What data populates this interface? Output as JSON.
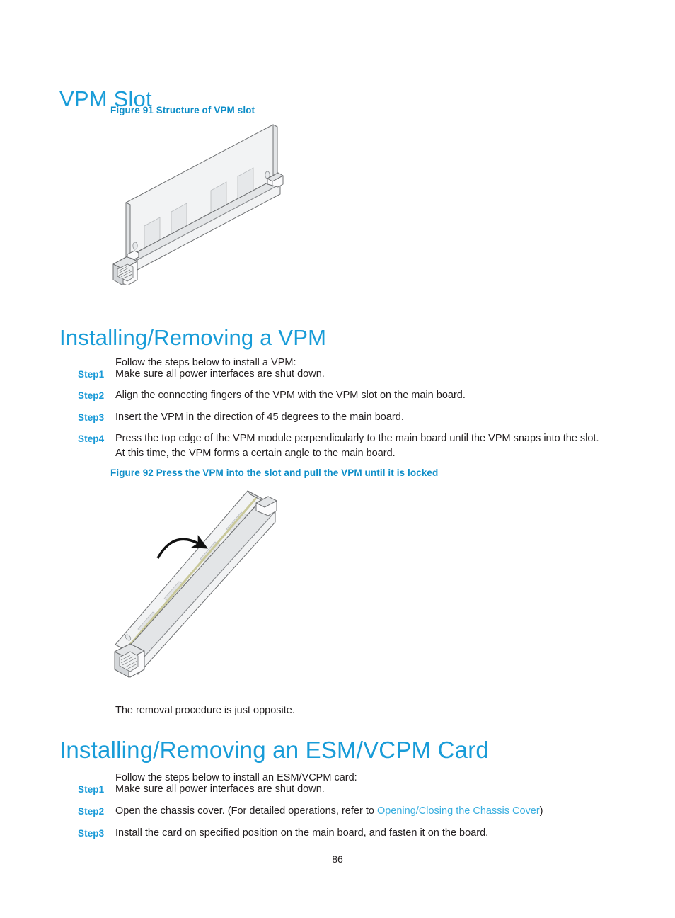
{
  "page": {
    "number": "86"
  },
  "sections": {
    "vpm_slot": {
      "heading": "VPM Slot",
      "figure_caption": "Figure 91 Structure of VPM slot"
    },
    "installing_vpm": {
      "heading": "Installing/Removing a VPM",
      "intro": "Follow the steps below to install a VPM:",
      "steps": [
        {
          "label": "Step1",
          "text": "Make sure all power interfaces are shut down."
        },
        {
          "label": "Step2",
          "text": "Align the connecting fingers of the VPM with the VPM slot on the main board."
        },
        {
          "label": "Step3",
          "text": "Insert the VPM in the direction of 45 degrees to the main board."
        },
        {
          "label": "Step4",
          "text": "Press the top edge of the VPM module perpendicularly to the main board until the VPM snaps into the slot.",
          "text_line2": "At this time, the VPM forms a certain angle to the main board."
        }
      ],
      "figure_caption": "Figure 92 Press the VPM into the slot and pull the VPM until it is locked",
      "closing": "The removal procedure is just opposite."
    },
    "installing_esm": {
      "heading": "Installing/Removing an ESM/VCPM Card",
      "intro": "Follow the steps below to install an ESM/VCPM card:",
      "steps": [
        {
          "label": "Step1",
          "text": "Make sure all power interfaces are shut down."
        },
        {
          "label": "Step2",
          "text_before": "Open the chassis cover. (For detailed operations, refer to ",
          "link_text": "Opening/Closing the Chassis Cover",
          "text_after": ")"
        },
        {
          "label": "Step3",
          "text": "Install the card on specified position on the main board, and fasten it on the board."
        }
      ]
    }
  },
  "colors": {
    "heading_blue": "#189cd8",
    "caption_blue": "#0e8ec8",
    "step_blue": "#1a9ad7",
    "link_blue": "#3aafe0",
    "body_text": "#231f20"
  }
}
